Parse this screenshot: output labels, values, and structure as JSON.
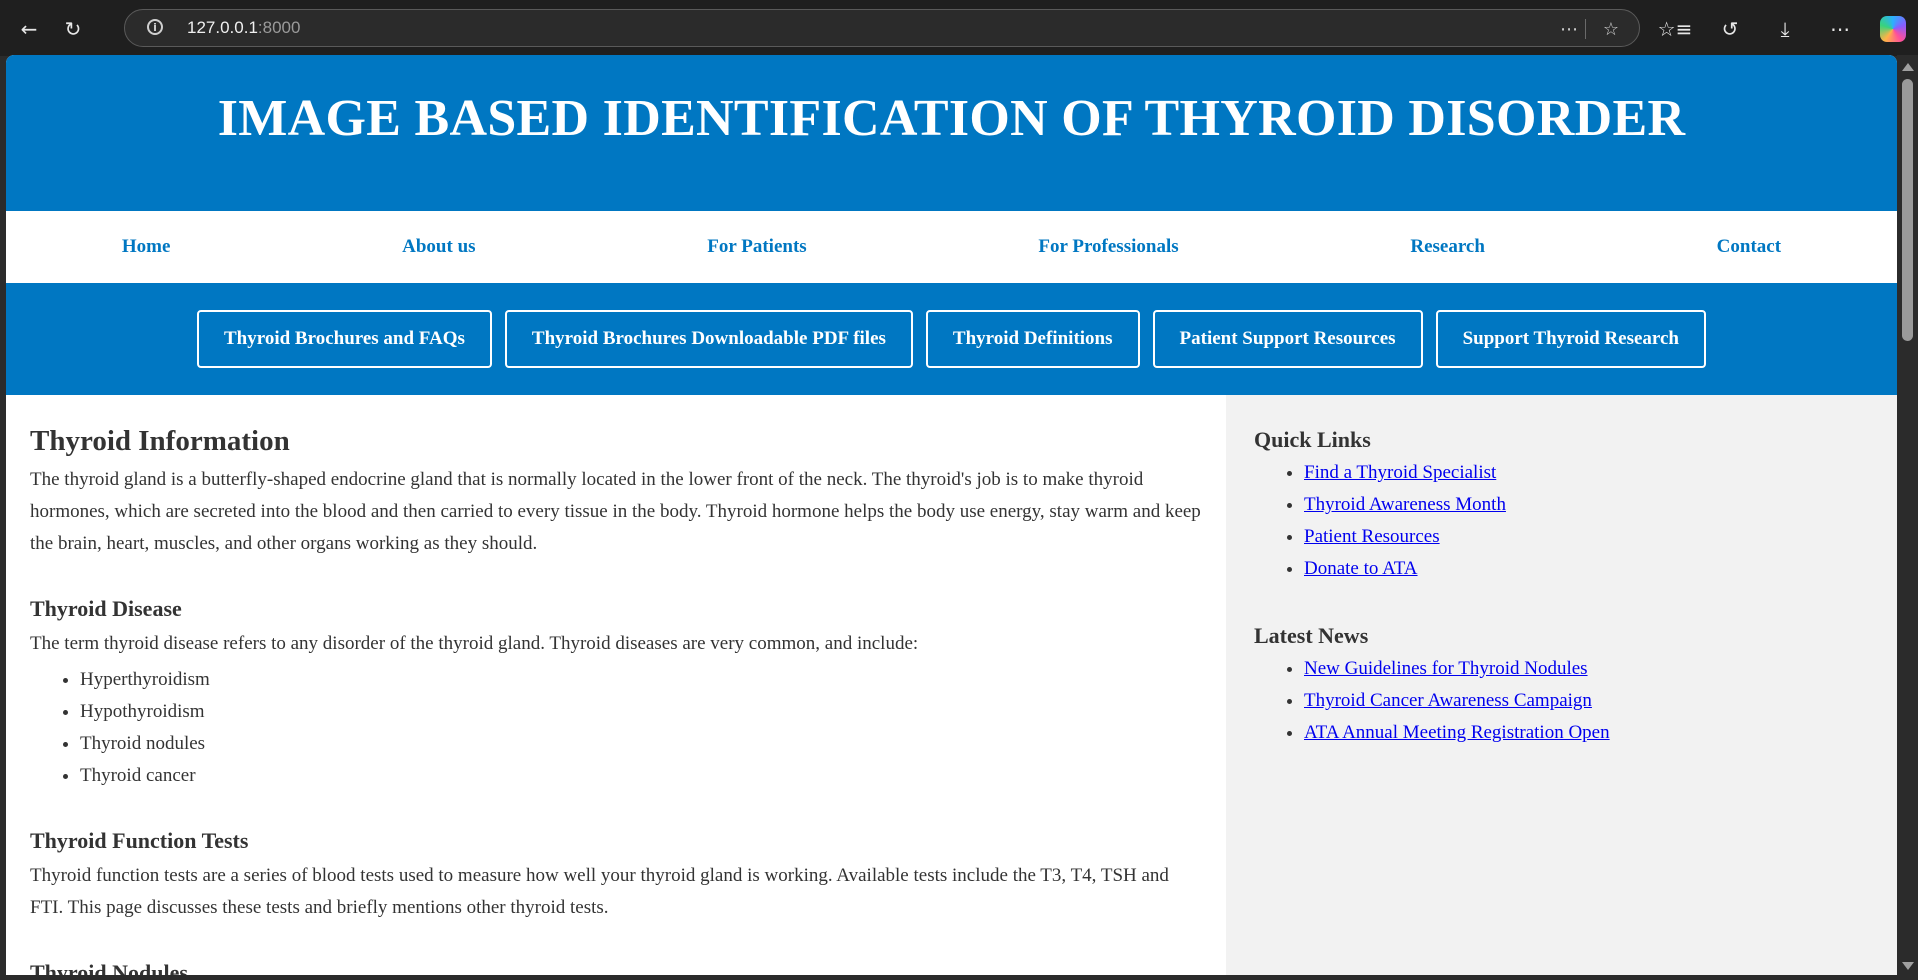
{
  "browser": {
    "url_host": "127.0.0.1",
    "url_port": ":8000"
  },
  "site": {
    "title": "IMAGE BASED IDENTIFICATION OF THYROID DISORDER"
  },
  "main_nav": [
    {
      "label": "Home"
    },
    {
      "label": "About us"
    },
    {
      "label": "For Patients"
    },
    {
      "label": "For Professionals"
    },
    {
      "label": "Research"
    },
    {
      "label": "Contact"
    }
  ],
  "sub_nav": [
    {
      "label": "Thyroid Brochures and FAQs"
    },
    {
      "label": "Thyroid Brochures Downloadable PDF files"
    },
    {
      "label": "Thyroid Definitions"
    },
    {
      "label": "Patient Support Resources"
    },
    {
      "label": "Support Thyroid Research"
    }
  ],
  "main": {
    "heading": "Thyroid Information",
    "intro": "The thyroid gland is a butterfly-shaped endocrine gland that is normally located in the lower front of the neck. The thyroid's job is to make thyroid hormones, which are secreted into the blood and then carried to every tissue in the body. Thyroid hormone helps the body use energy, stay warm and keep the brain, heart, muscles, and other organs working as they should.",
    "disease_heading": "Thyroid Disease",
    "disease_text": "The term thyroid disease refers to any disorder of the thyroid gland. Thyroid diseases are very common, and include:",
    "disease_list": [
      "Hyperthyroidism",
      "Hypothyroidism",
      "Thyroid nodules",
      "Thyroid cancer"
    ],
    "tests_heading": "Thyroid Function Tests",
    "tests_text": "Thyroid function tests are a series of blood tests used to measure how well your thyroid gland is working. Available tests include the T3, T4, TSH and FTI. This page discusses these tests and briefly mentions other thyroid tests.",
    "nodules_heading": "Thyroid Nodules"
  },
  "sidebar": {
    "quick_links_heading": "Quick Links",
    "quick_links": [
      {
        "label": "Find a Thyroid Specialist"
      },
      {
        "label": "Thyroid Awareness Month"
      },
      {
        "label": "Patient Resources"
      },
      {
        "label": "Donate to ATA"
      }
    ],
    "news_heading": "Latest News",
    "news": [
      {
        "label": "New Guidelines for Thyroid Nodules"
      },
      {
        "label": "Thyroid Cancer Awareness Campaign"
      },
      {
        "label": "ATA Annual Meeting Registration Open"
      }
    ]
  },
  "colors": {
    "brand_blue": "#0077c2",
    "link_blue": "#0000ee",
    "sidebar_bg": "#f2f2f2"
  },
  "icons": [
    "back-arrow-icon",
    "refresh-icon",
    "info-icon",
    "reading-mode-icon",
    "favorite-star-icon",
    "favorites-list-icon",
    "history-icon",
    "download-icon",
    "more-menu-icon",
    "copilot-icon"
  ]
}
